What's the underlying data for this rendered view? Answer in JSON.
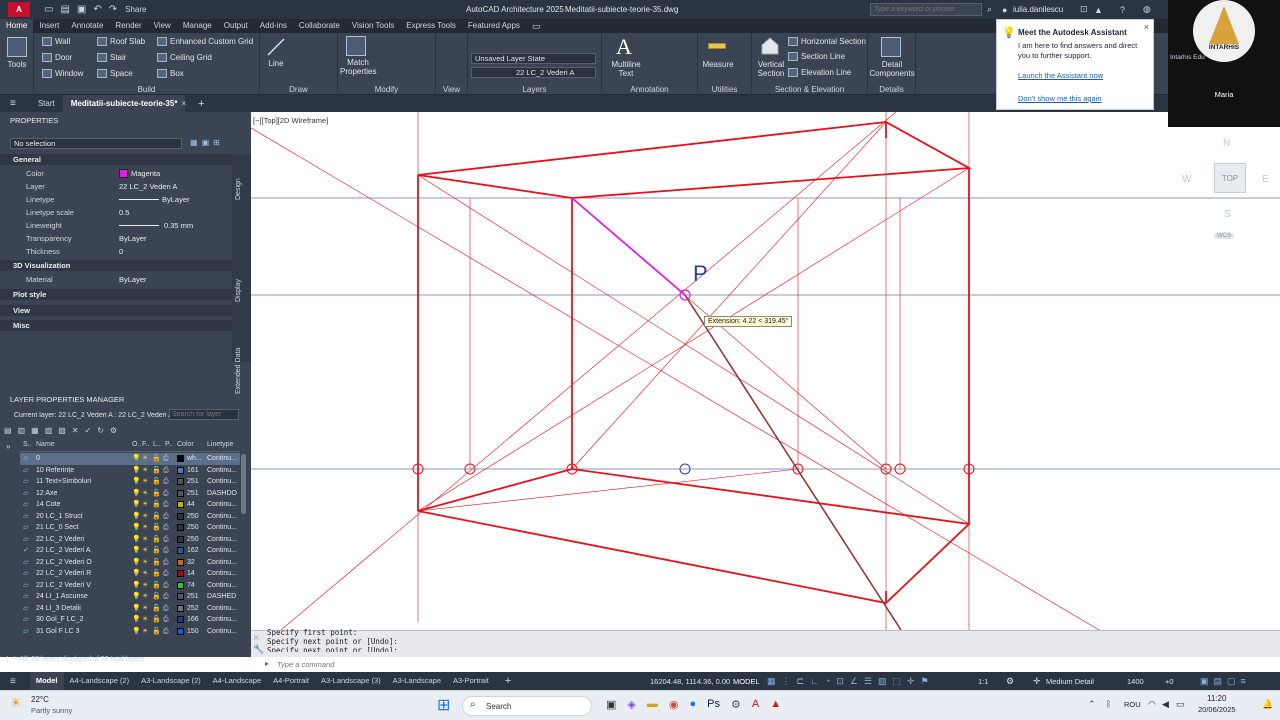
{
  "titlebar": {
    "app_title": "AutoCAD Architecture 2025",
    "file_title": "Meditatii-subiecte-teorie-35.dwg",
    "share": "Share",
    "search_placeholder": "Type a keyword or phrase",
    "user": "iulia.danilescu"
  },
  "menu": [
    "Home",
    "Insert",
    "Annotate",
    "Render",
    "View",
    "Manage",
    "Output",
    "Add-ins",
    "Collaborate",
    "Vision Tools",
    "Express Tools",
    "Featured Apps"
  ],
  "ribbon": {
    "tools": "Tools",
    "build": {
      "title": "Build",
      "items": [
        "Wall",
        "Door",
        "Window",
        "Roof Slab",
        "Stair",
        "Space",
        "Enhanced Custom Grid",
        "Ceiling Grid",
        "Box"
      ]
    },
    "draw": {
      "title": "Draw",
      "line": "Line"
    },
    "modify": {
      "title": "Modify",
      "match_properties": "Match Properties"
    },
    "view": {
      "title": "View"
    },
    "layers": {
      "title": "Layers",
      "state": "Unsaved Layer State",
      "current": "22 LC_2 Vederi A"
    },
    "annotation": {
      "title": "Annotation",
      "multiline_text": "Multiline Text"
    },
    "utilities": {
      "title": "Utilities",
      "measure": "Measure"
    },
    "section": {
      "title": "Section & Elevation",
      "vertical_section": "Vertical Section",
      "horizontal_section": "Horizontal Section",
      "section_line": "Section Line",
      "elevation_line": "Elevation Line"
    },
    "details": {
      "title": "Details",
      "detail_components": "Detail Components"
    }
  },
  "doctabs": {
    "start": "Start",
    "active": "Meditatii-subiecte-teorie-35*"
  },
  "properties": {
    "title": "PROPERTIES",
    "selection": "No selection",
    "general": "General",
    "rows": [
      {
        "k": "Color",
        "v": "Magenta"
      },
      {
        "k": "Layer",
        "v": "22 LC_2 Vederi A"
      },
      {
        "k": "Linetype",
        "v": "ByLayer"
      },
      {
        "k": "Linetype scale",
        "v": "0.5"
      },
      {
        "k": "Lineweight",
        "v": "0.35 mm"
      },
      {
        "k": "Transparency",
        "v": "ByLayer"
      },
      {
        "k": "Thickness",
        "v": "0"
      }
    ],
    "viz": "3D Visualization",
    "material_k": "Material",
    "material_v": "ByLayer",
    "collapsed": [
      "Plot style",
      "View",
      "Misc"
    ],
    "side_tabs": [
      "Design",
      "Display",
      "Extended Data"
    ]
  },
  "layers": {
    "title": "LAYER PROPERTIES MANAGER",
    "current": "Current layer: 22 LC_2 Vederi A : 22 LC_2 Vederi A",
    "search_placeholder": "Search for layer",
    "headers": [
      "S..",
      "Name",
      "O..",
      "F..",
      "L..",
      "P..",
      "Color",
      "Linetype"
    ],
    "rows": [
      {
        "name": "0",
        "color": "wh...",
        "lt": "Continu...",
        "hex": "#000000"
      },
      {
        "name": "10 Referințe",
        "color": "161",
        "lt": "Continu...",
        "hex": "#3f7fbf"
      },
      {
        "name": "11 Text+Simboluri",
        "color": "251",
        "lt": "Continu...",
        "hex": "#555555"
      },
      {
        "name": "12 Axe",
        "color": "251",
        "lt": "DASHDO",
        "hex": "#555555"
      },
      {
        "name": "14 Cote",
        "color": "44",
        "lt": "Continu...",
        "hex": "#bfb300"
      },
      {
        "name": "20 LC_1 Struct",
        "color": "250",
        "lt": "Continu...",
        "hex": "#333333"
      },
      {
        "name": "21 LC_0 Sect",
        "color": "250",
        "lt": "Continu...",
        "hex": "#333333"
      },
      {
        "name": "22 LC_2 Vederi",
        "color": "250",
        "lt": "Continu...",
        "hex": "#333333"
      },
      {
        "name": "22 LC_2 Vederi A",
        "color": "162",
        "lt": "Continu...",
        "hex": "#1f5fa0"
      },
      {
        "name": "22 LC_2 Vederi O",
        "color": "32",
        "lt": "Continu...",
        "hex": "#c0682a"
      },
      {
        "name": "22 LC_2 Vederi R",
        "color": "14",
        "lt": "Continu...",
        "hex": "#a01010"
      },
      {
        "name": "22 LC_2 Vederi V",
        "color": "74",
        "lt": "Continu...",
        "hex": "#3fbf3f"
      },
      {
        "name": "24 LI_1 Ascunse",
        "color": "251",
        "lt": "DASHED",
        "hex": "#555555"
      },
      {
        "name": "24 LI_3 Detalii",
        "color": "252",
        "lt": "Continu...",
        "hex": "#777777"
      },
      {
        "name": "30 Gol_F LC_2",
        "color": "166",
        "lt": "Continu...",
        "hex": "#1f3f7f"
      },
      {
        "name": "31 Gol F LC 3",
        "color": "150",
        "lt": "Continu...",
        "hex": "#1f5fbf"
      }
    ],
    "footer": "All: 38 layers displayed of 38 total layers"
  },
  "canvas": {
    "viewport_label": "[−][Top][2D Wireframe]",
    "point_label": "P",
    "tooltip": "Extension: 4.22 < 319.45°",
    "stroke_red": "#e8111b",
    "stroke_magenta": "#e21ee2",
    "stroke_blue": "#2f3f9f"
  },
  "viewcube": {
    "n": "N",
    "s": "S",
    "e": "E",
    "w": "W",
    "top": "TOP",
    "wcs": "WCS"
  },
  "assistant": {
    "title": "Meet the Autodesk Assistant",
    "body": "I am here to find answers and direct you to further support.",
    "link1": "Launch the Assistant now",
    "link2": "Don't show me this again"
  },
  "camera": {
    "name": "Maria",
    "logo": "INTARHIS",
    "tag": "Intarhis Edu"
  },
  "command": {
    "lines": [
      "Specify first point:",
      "Specify next point or [Undo]:",
      "Specify next point or [Undo]:"
    ],
    "placeholder": "Type a command"
  },
  "layout_tabs": [
    "Model",
    "A4-Landscape (2)",
    "A3-Landscape (2)",
    "A4-Landscape",
    "A4-Portrait",
    "A3-Landscape (3)",
    "A3-Landscape",
    "A3-Portrait"
  ],
  "status": {
    "coords": "16204.48, 1114.36, 0.00",
    "model": "MODEL",
    "scale": "1:1",
    "detail": "Medium Detail",
    "val": "1400",
    "plus": "+0"
  },
  "taskbar": {
    "temp": "22°C",
    "weather": "Partly sunny",
    "search": "Search",
    "lang": "ROU",
    "time": "11:20",
    "date": "20/06/2025"
  }
}
